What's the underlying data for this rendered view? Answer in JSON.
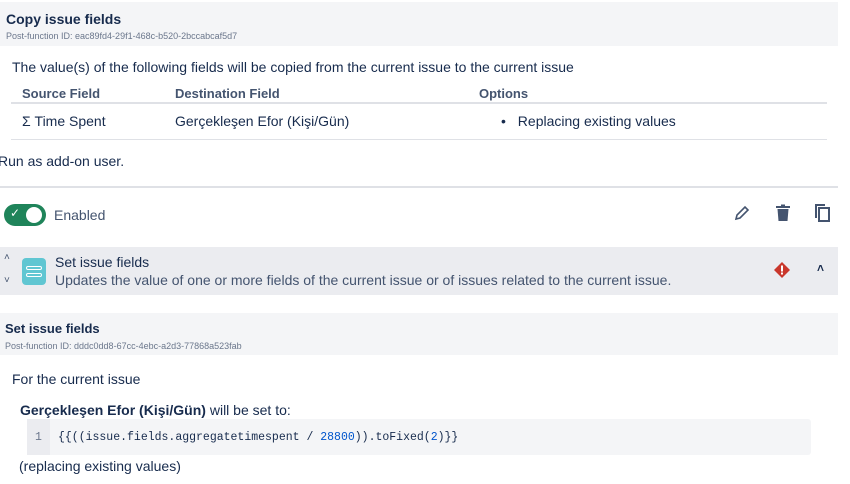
{
  "copy": {
    "title": "Copy issue fields",
    "id": "Post-function ID: eac89fd4-29f1-468c-b520-2bccabcaf5d7",
    "desc": "The value(s) of the following fields will be copied from the current issue to the current issue",
    "headers": [
      "Source Field",
      "Destination Field",
      "Options"
    ],
    "row": {
      "source": "Σ Time Spent",
      "dest": "Gerçekleşen Efor (Kişi/Gün)",
      "option": "Replacing existing values"
    },
    "run_as": "Run as add-on user."
  },
  "toggle": {
    "label": "Enabled",
    "on": true
  },
  "set": {
    "title": "Set issue fields",
    "desc": "Updates the value of one or more fields of the current issue or of issues related to the current issue.",
    "detail_title": "Set issue fields",
    "id": "Post-function ID: dddc0dd8-67cc-4ebc-a2d3-77868a523fab",
    "for": "For the current issue",
    "field": "Gerçekleşen Efor (Kişi/Gün)",
    "will": " will be set to:",
    "line_no": "1",
    "code_a": "{{((issue.fields.aggregatetimespent / ",
    "code_num": "28800",
    "code_b": ")).toFixed(",
    "code_num2": "2",
    "code_c": ")}}",
    "replacing": "(replacing existing values)"
  },
  "colors": {
    "toggle": "#1f845a",
    "error": "#c9372c",
    "teal": "#60c6d2"
  }
}
